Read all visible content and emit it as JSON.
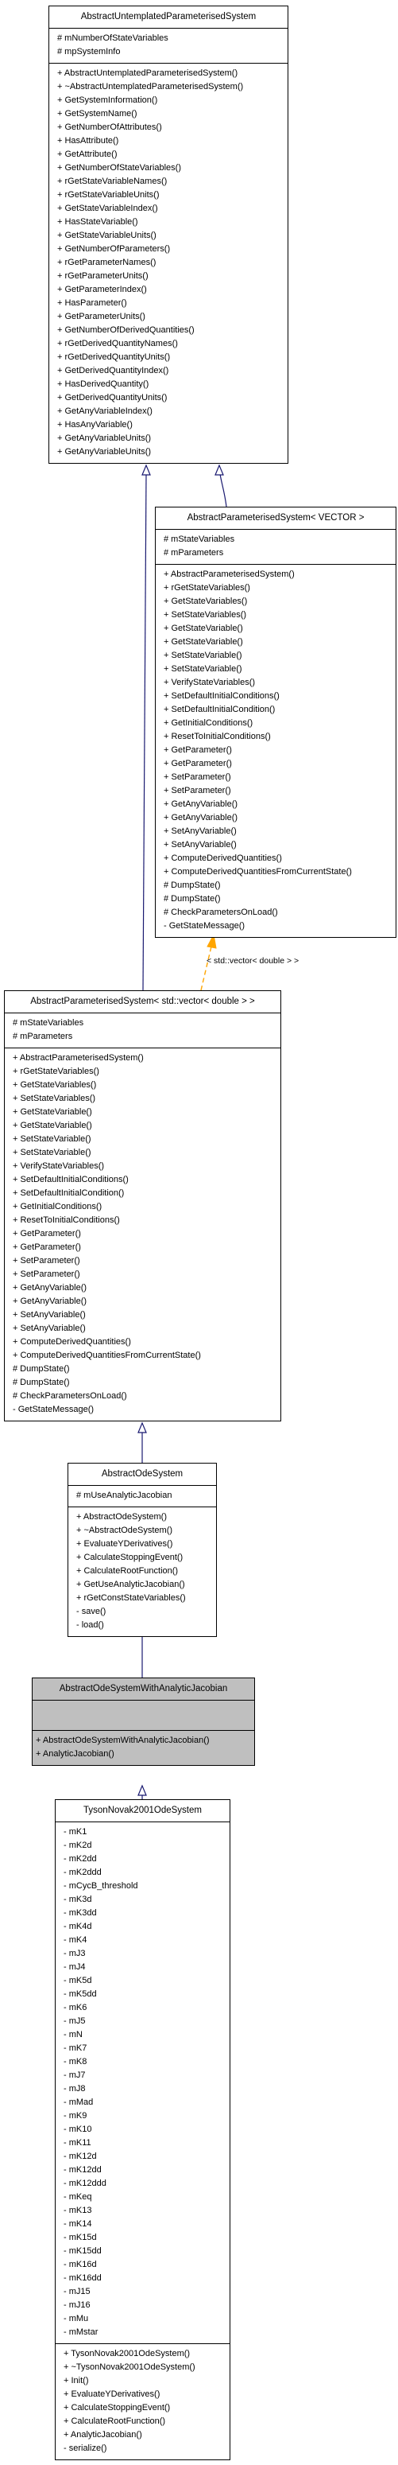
{
  "classes": {
    "untemplated": {
      "name": "AbstractUntemplatedParameterisedSystem",
      "attributes": [
        "# mNumberOfStateVariables",
        "# mpSystemInfo"
      ],
      "operations": [
        "+ AbstractUntemplatedParameterisedSystem()",
        "+ ~AbstractUntemplatedParameterisedSystem()",
        "+ GetSystemInformation()",
        "+ GetSystemName()",
        "+ GetNumberOfAttributes()",
        "+ HasAttribute()",
        "+ GetAttribute()",
        "+ GetNumberOfStateVariables()",
        "+ rGetStateVariableNames()",
        "+ rGetStateVariableUnits()",
        "+ GetStateVariableIndex()",
        "+ HasStateVariable()",
        "+ GetStateVariableUnits()",
        "+ GetNumberOfParameters()",
        "+ rGetParameterNames()",
        "+ rGetParameterUnits()",
        "+ GetParameterIndex()",
        "+ HasParameter()",
        "+ GetParameterUnits()",
        "+ GetNumberOfDerivedQuantities()",
        "+ rGetDerivedQuantityNames()",
        "+ rGetDerivedQuantityUnits()",
        "+ GetDerivedQuantityIndex()",
        "+ HasDerivedQuantity()",
        "+ GetDerivedQuantityUnits()",
        "+ GetAnyVariableIndex()",
        "+ HasAnyVariable()",
        "+ GetAnyVariableUnits()",
        "+ GetAnyVariableUnits()"
      ]
    },
    "vector_template": {
      "name": "AbstractParameterisedSystem< VECTOR >",
      "attributes": [
        "# mStateVariables",
        "# mParameters"
      ],
      "operations": [
        "+ AbstractParameterisedSystem()",
        "+ rGetStateVariables()",
        "+ GetStateVariables()",
        "+ SetStateVariables()",
        "+ GetStateVariable()",
        "+ GetStateVariable()",
        "+ SetStateVariable()",
        "+ SetStateVariable()",
        "+ VerifyStateVariables()",
        "+ SetDefaultInitialConditions()",
        "+ SetDefaultInitialCondition()",
        "+ GetInitialConditions()",
        "+ ResetToInitialConditions()",
        "+ GetParameter()",
        "+ GetParameter()",
        "+ SetParameter()",
        "+ SetParameter()",
        "+ GetAnyVariable()",
        "+ GetAnyVariable()",
        "+ SetAnyVariable()",
        "+ SetAnyVariable()",
        "+ ComputeDerivedQuantities()",
        "+ ComputeDerivedQuantitiesFromCurrentState()",
        "# DumpState()",
        "# DumpState()",
        "# CheckParametersOnLoad()",
        "- GetStateMessage()"
      ]
    },
    "std_vector": {
      "name": "AbstractParameterisedSystem< std::vector< double > >",
      "attributes": [
        "# mStateVariables",
        "# mParameters"
      ],
      "operations": [
        "+ AbstractParameterisedSystem()",
        "+ rGetStateVariables()",
        "+ GetStateVariables()",
        "+ SetStateVariables()",
        "+ GetStateVariable()",
        "+ GetStateVariable()",
        "+ SetStateVariable()",
        "+ SetStateVariable()",
        "+ VerifyStateVariables()",
        "+ SetDefaultInitialConditions()",
        "+ SetDefaultInitialCondition()",
        "+ GetInitialConditions()",
        "+ ResetToInitialConditions()",
        "+ GetParameter()",
        "+ GetParameter()",
        "+ SetParameter()",
        "+ SetParameter()",
        "+ GetAnyVariable()",
        "+ GetAnyVariable()",
        "+ SetAnyVariable()",
        "+ SetAnyVariable()",
        "+ ComputeDerivedQuantities()",
        "+ ComputeDerivedQuantitiesFromCurrentState()",
        "# DumpState()",
        "# DumpState()",
        "# CheckParametersOnLoad()",
        "- GetStateMessage()"
      ]
    },
    "ode": {
      "name": "AbstractOdeSystem",
      "attributes": [
        "# mUseAnalyticJacobian"
      ],
      "operations": [
        "+ AbstractOdeSystem()",
        "+ ~AbstractOdeSystem()",
        "+ EvaluateYDerivatives()",
        "+ CalculateStoppingEvent()",
        "+ CalculateRootFunction()",
        "+ GetUseAnalyticJacobian()",
        "+ rGetConstStateVariables()",
        "- save()",
        "- load()"
      ]
    },
    "ode_jacobian": {
      "name": "AbstractOdeSystemWithAnalyticJacobian",
      "attributes": [],
      "operations": [
        "+ AbstractOdeSystemWithAnalyticJacobian()",
        "+ AnalyticJacobian()"
      ]
    },
    "tyson": {
      "name": "TysonNovak2001OdeSystem",
      "attributes": [
        "- mK1",
        "- mK2d",
        "- mK2dd",
        "- mK2ddd",
        "- mCycB_threshold",
        "- mK3d",
        "- mK3dd",
        "- mK4d",
        "- mK4",
        "- mJ3",
        "- mJ4",
        "- mK5d",
        "- mK5dd",
        "- mK6",
        "- mJ5",
        "- mN",
        "- mK7",
        "- mK8",
        "- mJ7",
        "- mJ8",
        "- mMad",
        "- mK9",
        "- mK10",
        "- mK11",
        "- mK12d",
        "- mK12dd",
        "- mK12ddd",
        "- mKeq",
        "- mK13",
        "- mK14",
        "- mK15d",
        "- mK15dd",
        "- mK16d",
        "- mK16dd",
        "- mJ15",
        "- mJ16",
        "- mMu",
        "- mMstar"
      ],
      "operations": [
        "+ TysonNovak2001OdeSystem()",
        "+ ~TysonNovak2001OdeSystem()",
        "+ Init()",
        "+ EvaluateYDerivatives()",
        "+ CalculateStoppingEvent()",
        "+ CalculateRootFunction()",
        "+ AnalyticJacobian()",
        "- serialize()"
      ]
    }
  },
  "template_binding_label": "< std::vector< double > >",
  "colors": {
    "inheritance_edge": "#191970",
    "template_edge": "#ffa500",
    "highlight_box": "#bfbfbf"
  }
}
